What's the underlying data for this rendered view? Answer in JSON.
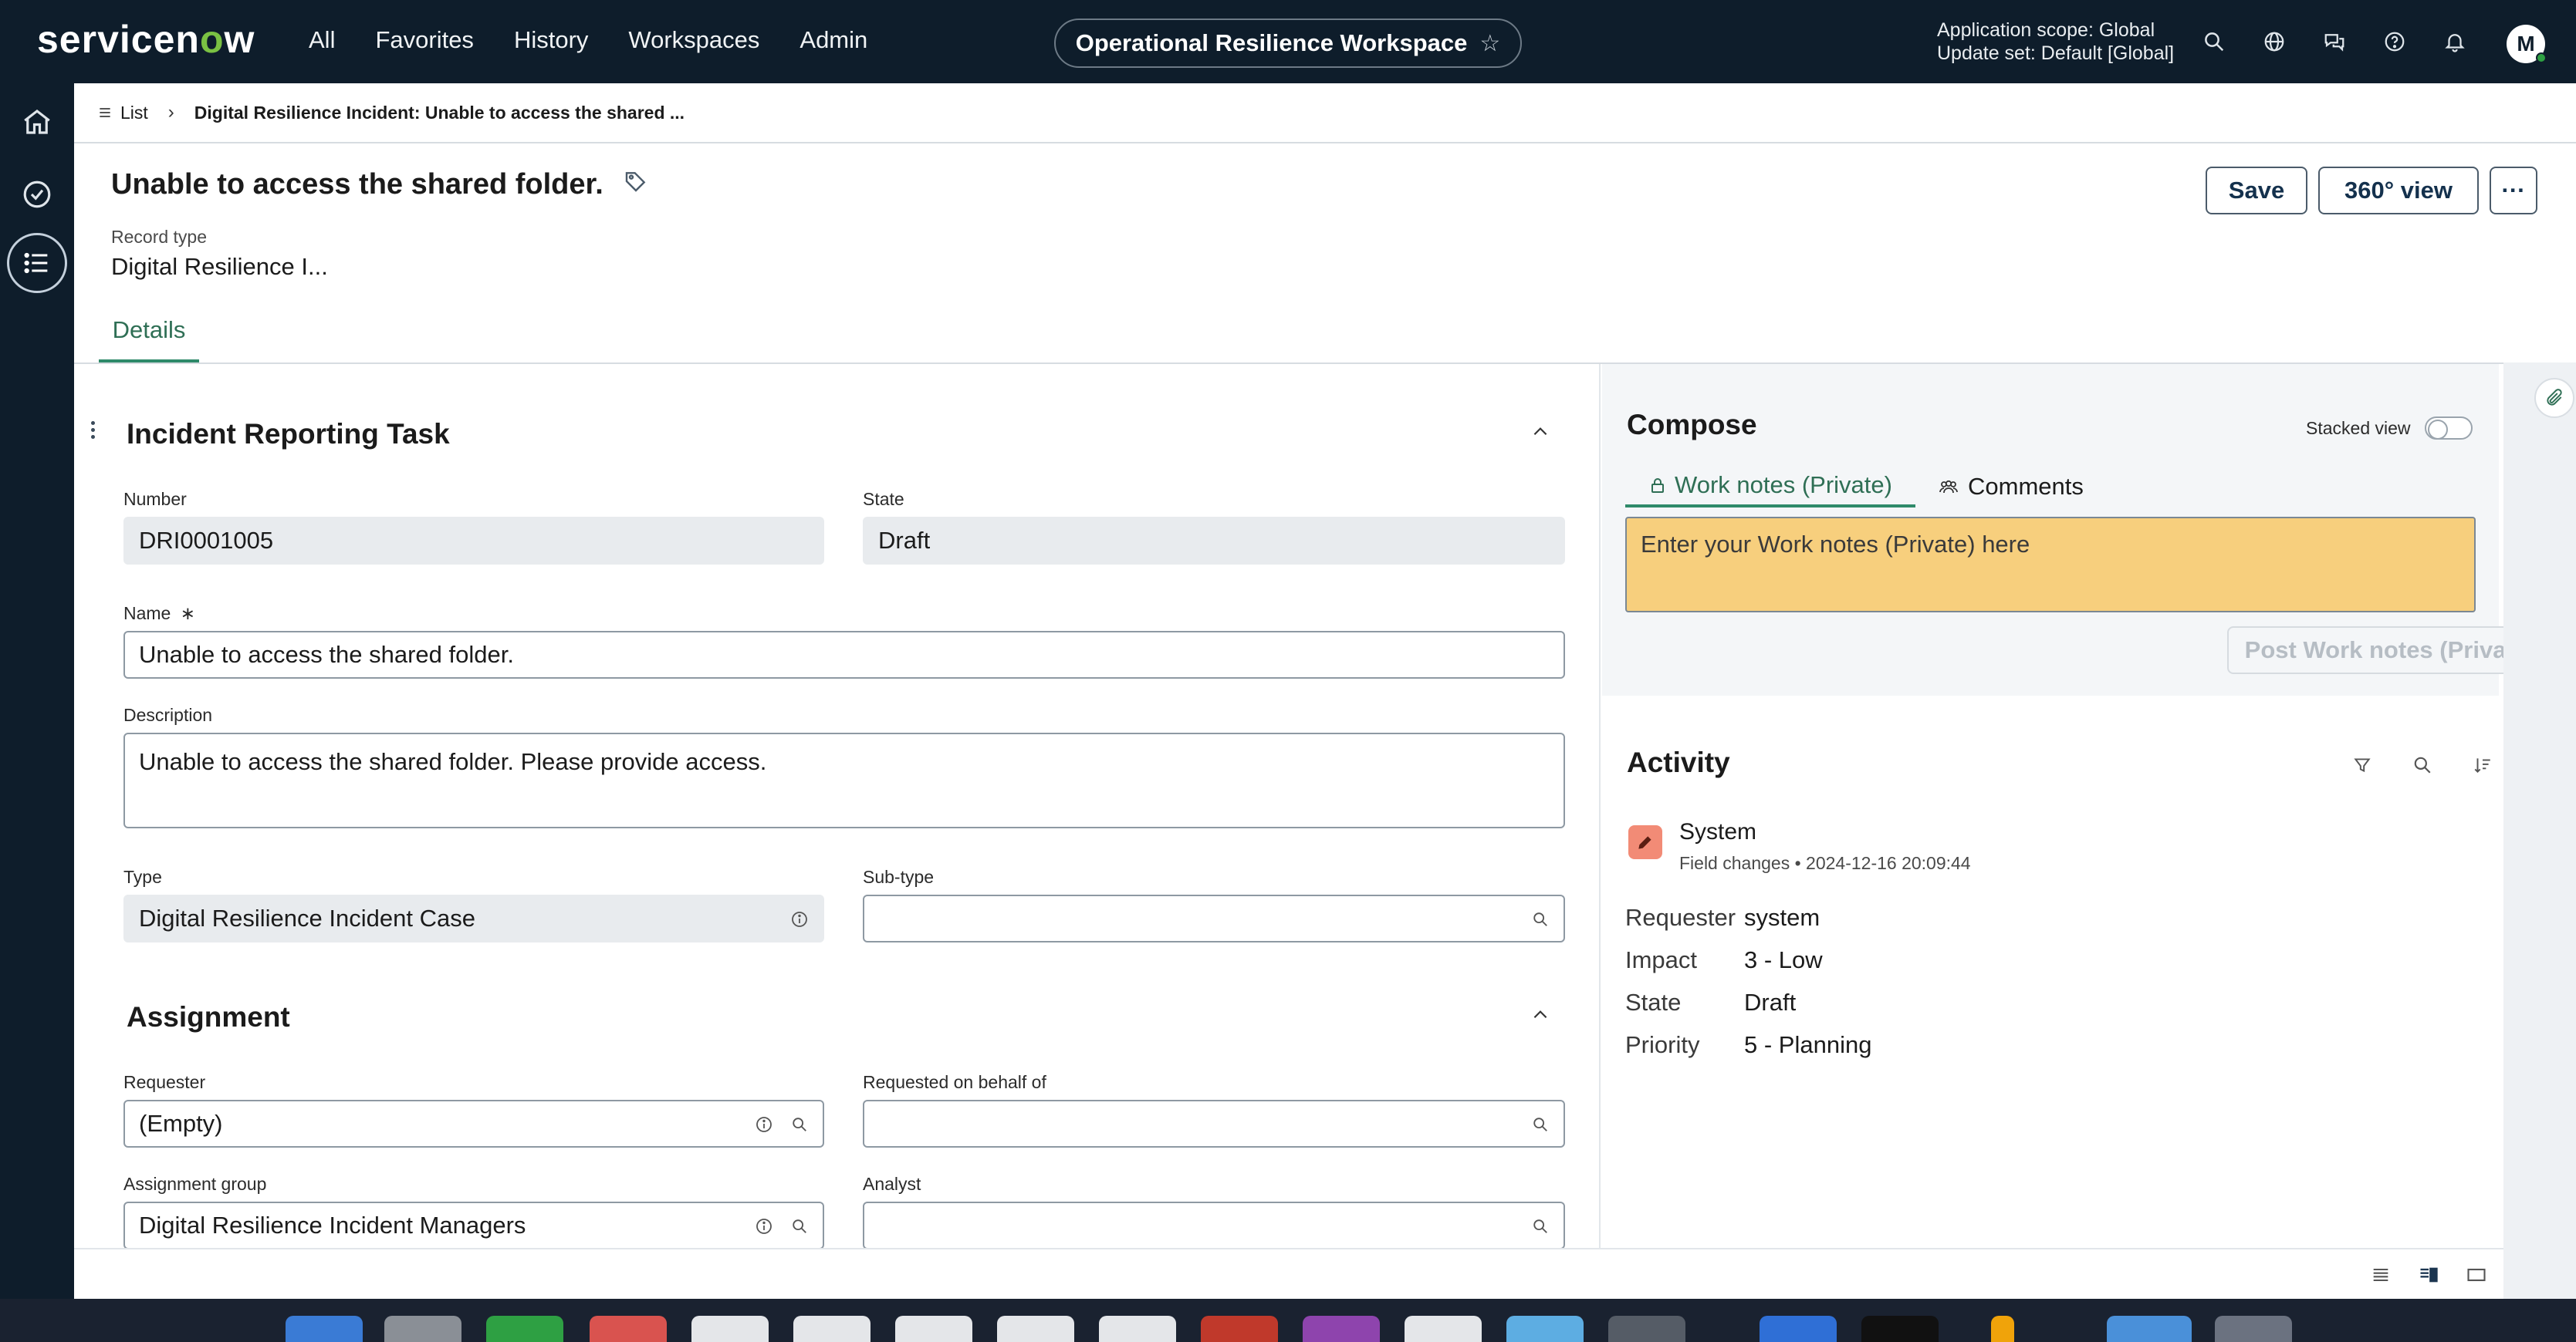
{
  "topnav": {
    "logo": "servicenow",
    "menu": [
      "All",
      "Favorites",
      "History",
      "Workspaces",
      "Admin"
    ],
    "workspace": "Operational Resilience Workspace",
    "scope_line1": "Application scope: Global",
    "scope_line2": "Update set: Default [Global]",
    "avatar": "M",
    "icons": [
      "search-icon",
      "globe-icon",
      "chat-icon",
      "help-icon",
      "bell-icon"
    ]
  },
  "breadcrumb": {
    "list": "List",
    "current": "Digital Resilience Incident: Unable to access the shared ..."
  },
  "record": {
    "title": "Unable to access the shared folder.",
    "type_label": "Record type",
    "type_value": "Digital Resilience I...",
    "save": "Save",
    "view360": "360° view",
    "more": "···",
    "tab": "Details"
  },
  "form": {
    "section1": "Incident Reporting Task",
    "number_label": "Number",
    "number_value": "DRI0001005",
    "state_label": "State",
    "state_value": "Draft",
    "name_label": "Name",
    "name_required": "∗",
    "name_value": "Unable to access the shared folder.",
    "desc_label": "Description",
    "desc_value": "Unable to access the shared folder. Please provide access.",
    "type_label": "Type",
    "type_value": "Digital Resilience Incident Case",
    "subtype_label": "Sub-type",
    "subtype_value": "",
    "section2": "Assignment",
    "requester_label": "Requester",
    "requester_value": "(Empty)",
    "behalf_label": "Requested on behalf of",
    "behalf_value": "",
    "group_label": "Assignment group",
    "group_value": "Digital Resilience Incident Managers",
    "analyst_label": "Analyst",
    "analyst_value": ""
  },
  "compose": {
    "title": "Compose",
    "stacked": "Stacked view",
    "tab_worknotes": "Work notes (Private)",
    "tab_comments": "Comments",
    "placeholder": "Enter your Work notes (Private) here",
    "post": "Post Work notes (Private)"
  },
  "activity": {
    "title": "Activity",
    "author": "System",
    "meta": "Field changes • 2024-12-16 20:09:44",
    "rows": [
      {
        "k": "Requester",
        "v": "system"
      },
      {
        "k": "Impact",
        "v": "3 - Low"
      },
      {
        "k": "State",
        "v": "Draft"
      },
      {
        "k": "Priority",
        "v": "5 - Planning"
      }
    ]
  },
  "colors": {
    "nav_bg": "#0e1d2b",
    "accent": "#2f8a6a",
    "logo_o": "#7ac143",
    "notes_bg": "#f7cf7d"
  }
}
